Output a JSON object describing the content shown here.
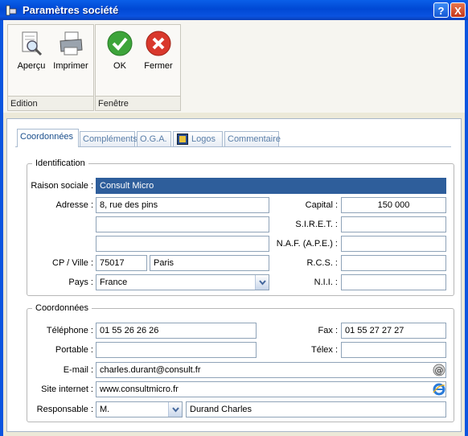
{
  "window": {
    "title": "Paramètres société",
    "help_label": "?",
    "close_label": "X"
  },
  "ribbon": {
    "groups": [
      {
        "caption": "Edition",
        "tools": [
          "Aperçu",
          "Imprimer"
        ]
      },
      {
        "caption": "Fenêtre",
        "tools": [
          "OK",
          "Fermer"
        ]
      }
    ]
  },
  "tabs": [
    "Coordonnées",
    "Compléments",
    "O.G.A.",
    "Logos",
    "Commentaire"
  ],
  "identification": {
    "legend": "Identification",
    "raison_sociale_label": "Raison sociale :",
    "raison_sociale": "Consult Micro",
    "adresse_label": "Adresse :",
    "adresse1": "8, rue des pins",
    "adresse2": "",
    "adresse3": "",
    "cp_ville_label": "CP / Ville :",
    "cp": "75017",
    "ville": "Paris",
    "pays_label": "Pays :",
    "pays": "France",
    "capital_label": "Capital :",
    "capital": "150 000",
    "siret_label": "S.I.R.E.T. :",
    "siret": "",
    "naf_label": "N.A.F. (A.P.E.) :",
    "naf": "",
    "rcs_label": "R.C.S. :",
    "rcs": "",
    "nii_label": "N.I.I. :",
    "nii": ""
  },
  "coordonnees": {
    "legend": "Coordonnées",
    "telephone_label": "Téléphone :",
    "telephone": "01 55 26 26 26",
    "fax_label": "Fax :",
    "fax": "01 55 27 27 27",
    "portable_label": "Portable :",
    "portable": "",
    "telex_label": "Télex :",
    "telex": "",
    "email_label": "E-mail :",
    "email": "charles.durant@consult.fr",
    "site_label": "Site internet :",
    "site": "www.consultmicro.fr",
    "responsable_label": "Responsable :",
    "civilite": "M.",
    "responsable": "Durand Charles"
  }
}
